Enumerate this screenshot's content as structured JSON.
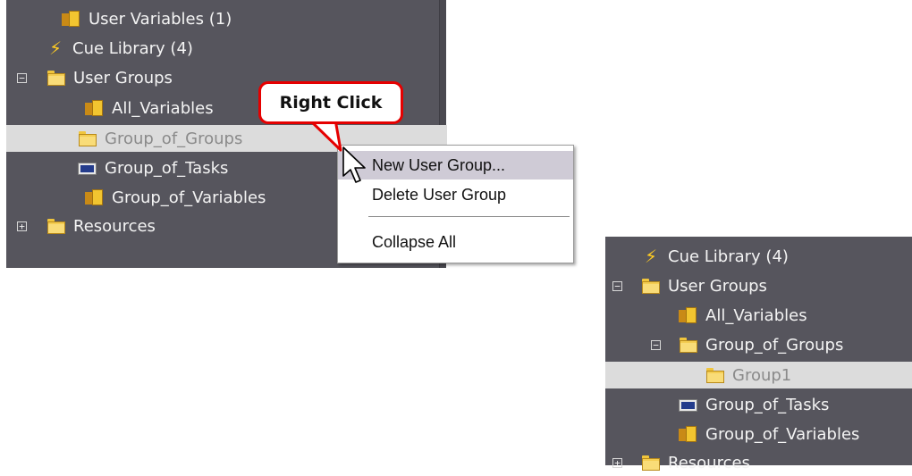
{
  "left_tree": {
    "items": [
      {
        "label": "User Variables (1)",
        "icon": "variables-icon"
      },
      {
        "label": "Cue Library (4)",
        "icon": "cue-library-icon"
      },
      {
        "label": "User Groups",
        "icon": "folder-icon",
        "expander": "⊟"
      },
      {
        "label": "All_Variables",
        "icon": "variables-icon"
      },
      {
        "label": "Group_of_Groups",
        "icon": "folder-icon",
        "selected": true
      },
      {
        "label": "Group_of_Tasks",
        "icon": "tasks-icon"
      },
      {
        "label": "Group_of_Variables",
        "icon": "variables-icon"
      },
      {
        "label": "Resources",
        "icon": "folder-icon",
        "expander": "⊞"
      }
    ]
  },
  "callout": {
    "text": "Right Click"
  },
  "context_menu": {
    "items": [
      {
        "label": "New User Group...",
        "highlighted": true
      },
      {
        "label": "Delete User Group"
      },
      {
        "label": "Collapse All"
      }
    ]
  },
  "right_tree": {
    "items": [
      {
        "label": "Cue Library (4)",
        "icon": "cue-library-icon"
      },
      {
        "label": "User Groups",
        "icon": "folder-icon",
        "expander": "⊟"
      },
      {
        "label": "All_Variables",
        "icon": "variables-icon"
      },
      {
        "label": "Group_of_Groups",
        "icon": "folder-icon",
        "expander": "⊟"
      },
      {
        "label": "Group1",
        "icon": "folder-icon",
        "selected": true
      },
      {
        "label": "Group_of_Tasks",
        "icon": "tasks-icon"
      },
      {
        "label": "Group_of_Variables",
        "icon": "variables-icon"
      },
      {
        "label": "Resources",
        "icon": "folder-icon",
        "expander": "⊞"
      }
    ]
  },
  "colors": {
    "panel_bg": "#56555d",
    "selection_bg": "#dcdcdc",
    "menu_highlight": "#cfcbd6",
    "callout_border": "#e50000"
  }
}
